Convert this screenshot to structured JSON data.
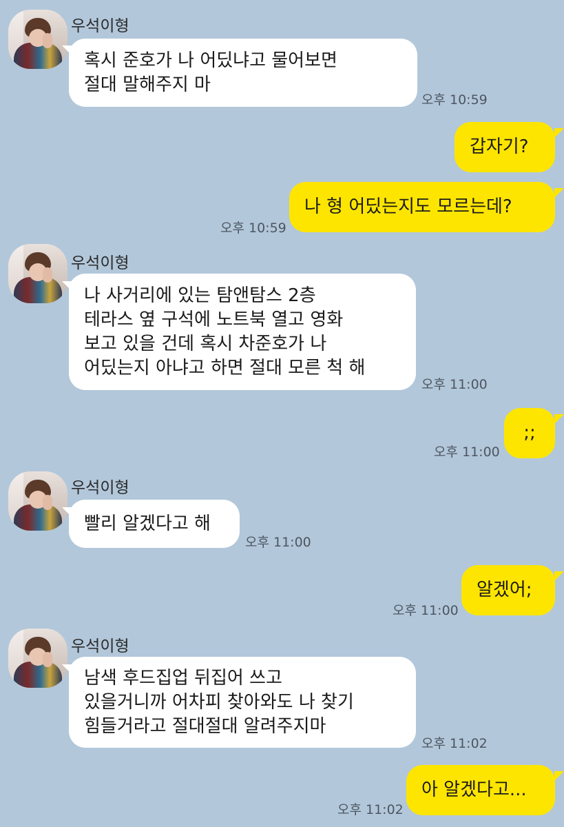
{
  "chat": {
    "sender_name": "우석이형",
    "messages": [
      {
        "from": "them",
        "lines": [
          "혹시 준호가 나 어딨냐고 물어보면",
          "절대 말해주지 마"
        ],
        "time": "오후 10:59"
      },
      {
        "from": "me",
        "lines": [
          "갑자기?"
        ]
      },
      {
        "from": "me",
        "lines": [
          "나 형 어딨는지도 모르는데?"
        ],
        "time": "오후 10:59"
      },
      {
        "from": "them",
        "lines": [
          "나 사거리에 있는 탐앤탐스 2층",
          "테라스 옆 구석에 노트북 열고 영화",
          "보고 있을 건데 혹시 차준호가 나",
          "어딨는지 아냐고 하면 절대 모른 척 해"
        ],
        "time": "오후 11:00"
      },
      {
        "from": "me",
        "lines": [
          ";;"
        ],
        "time": "오후 11:00"
      },
      {
        "from": "them",
        "lines": [
          "빨리 알겠다고 해"
        ],
        "time": "오후 11:00"
      },
      {
        "from": "me",
        "lines": [
          "알겠어;"
        ],
        "time": "오후 11:00"
      },
      {
        "from": "them",
        "lines": [
          "남색 후드집업 뒤집어 쓰고",
          "있을거니까 어차피 찾아와도 나 찾기",
          "힘들거라고 절대절대 알려주지마"
        ],
        "time": "오후 11:02"
      },
      {
        "from": "me",
        "lines": [
          "아 알겠다고..."
        ],
        "time": "오후 11:02"
      }
    ]
  }
}
